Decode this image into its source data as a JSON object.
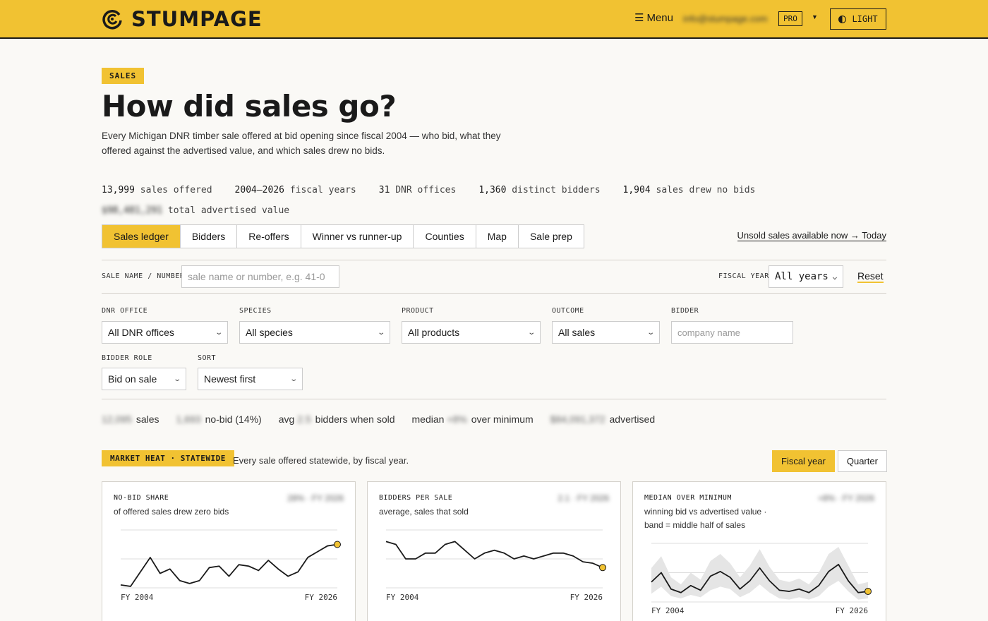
{
  "header": {
    "brand": "STUMPAGE",
    "menu_label": "Menu",
    "user_email": "info@stumpage.com",
    "plan_badge": "PRO",
    "theme_label": "LIGHT"
  },
  "hero": {
    "section_tag": "SALES",
    "title": "How did sales go?",
    "description": "Every Michigan DNR timber sale offered at bid opening since fiscal 2004 — who bid, what they offered against the advertised value, and which sales drew no bids."
  },
  "stats": [
    {
      "value": "13,999",
      "label": "sales offered"
    },
    {
      "value": "2004–2026",
      "label": "fiscal years"
    },
    {
      "value": "31",
      "label": "DNR offices"
    },
    {
      "value": "1,360",
      "label": "distinct bidders"
    },
    {
      "value": "1,904",
      "label": "sales drew no bids"
    }
  ],
  "advertised_total": {
    "value": "$98,481,291",
    "label": "total advertised value"
  },
  "tabs": [
    "Sales ledger",
    "Bidders",
    "Re-offers",
    "Winner vs runner-up",
    "Counties",
    "Map",
    "Sale prep"
  ],
  "active_tab": "Sales ledger",
  "unsold_link": "Unsold sales available now → Today",
  "filters": {
    "sale_name_label": "SALE NAME / NUMBER",
    "sale_name_placeholder": "sale name or number, e.g. 41-0",
    "fiscal_year_label": "FISCAL YEAR",
    "fiscal_year_value": "All years",
    "reset_label": "Reset",
    "dnr_office_label": "DNR OFFICE",
    "dnr_office_value": "All DNR offices",
    "species_label": "SPECIES",
    "species_value": "All species",
    "product_label": "PRODUCT",
    "product_value": "All products",
    "outcome_label": "OUTCOME",
    "outcome_value": "All sales",
    "bidder_label": "BIDDER",
    "bidder_placeholder": "company name",
    "bidder_role_label": "BIDDER ROLE",
    "bidder_role_value": "Bid on sale",
    "sort_label": "SORT",
    "sort_value": "Newest first"
  },
  "summary": {
    "sales_value": "12,095",
    "sales_label": "sales",
    "nobid_value": "1,693",
    "nobid_label": "no-bid (14%)",
    "avg_prefix": "avg",
    "avg_value": "2.5",
    "avg_label": "bidders when sold",
    "median_prefix": "median",
    "median_value": "+8%",
    "median_label": "over minimum",
    "advertised_value": "$84,091,372",
    "advertised_label": "advertised"
  },
  "market_heat": {
    "tag": "MARKET HEAT · STATEWIDE",
    "description": "Every sale offered statewide, by fiscal year.",
    "period_options": [
      "Fiscal year",
      "Quarter"
    ],
    "active_period": "Fiscal year"
  },
  "cards": [
    {
      "title": "NO-BID SHARE",
      "subtitle": "of offered sales drew zero bids",
      "value": "28% · FY 2026",
      "x_start": "FY 2004",
      "x_end": "FY 2026"
    },
    {
      "title": "BIDDERS PER SALE",
      "subtitle": "average, sales that sold",
      "value": "2.1 · FY 2026",
      "x_start": "FY 2004",
      "x_end": "FY 2026"
    },
    {
      "title": "MEDIAN OVER MINIMUM",
      "subtitle": "winning bid vs advertised value · band = middle half of sales",
      "value": "+8% · FY 2026",
      "x_start": "FY 2004",
      "x_end": "FY 2026"
    }
  ],
  "chart_data": [
    {
      "type": "line",
      "title": "NO-BID SHARE",
      "x": [
        "FY 2004",
        "FY 2005",
        "FY 2006",
        "FY 2007",
        "FY 2008",
        "FY 2009",
        "FY 2010",
        "FY 2011",
        "FY 2012",
        "FY 2013",
        "FY 2014",
        "FY 2015",
        "FY 2016",
        "FY 2017",
        "FY 2018",
        "FY 2019",
        "FY 2020",
        "FY 2021",
        "FY 2022",
        "FY 2023",
        "FY 2024",
        "FY 2025",
        "FY 2026"
      ],
      "series": [
        {
          "values": [
            0.02,
            0.01,
            0.11,
            0.21,
            0.1,
            0.13,
            0.05,
            0.03,
            0.05,
            0.14,
            0.15,
            0.08,
            0.16,
            0.15,
            0.12,
            0.19,
            0.13,
            0.08,
            0.11,
            0.21,
            0.25,
            0.29,
            0.3
          ]
        }
      ],
      "ylim": [
        0,
        0.4
      ],
      "color": "#1a1a1a",
      "highlight_color": "#f1c232"
    },
    {
      "type": "line",
      "title": "BIDDERS PER SALE",
      "x": [
        "FY 2004",
        "FY 2005",
        "FY 2006",
        "FY 2007",
        "FY 2008",
        "FY 2009",
        "FY 2010",
        "FY 2011",
        "FY 2012",
        "FY 2013",
        "FY 2014",
        "FY 2015",
        "FY 2016",
        "FY 2017",
        "FY 2018",
        "FY 2019",
        "FY 2020",
        "FY 2021",
        "FY 2022",
        "FY 2023",
        "FY 2024",
        "FY 2025",
        "FY 2026"
      ],
      "series": [
        {
          "values": [
            3.1,
            3.0,
            2.5,
            2.5,
            2.7,
            2.7,
            3.0,
            3.1,
            2.8,
            2.5,
            2.7,
            2.8,
            2.7,
            2.5,
            2.6,
            2.5,
            2.6,
            2.7,
            2.7,
            2.6,
            2.4,
            2.35,
            2.2
          ]
        }
      ],
      "ylim": [
        1.5,
        3.5
      ],
      "color": "#1a1a1a",
      "highlight_color": "#f1c232"
    },
    {
      "type": "line",
      "title": "MEDIAN OVER MINIMUM",
      "x": [
        "FY 2004",
        "FY 2005",
        "FY 2006",
        "FY 2007",
        "FY 2008",
        "FY 2009",
        "FY 2010",
        "FY 2011",
        "FY 2012",
        "FY 2013",
        "FY 2014",
        "FY 2015",
        "FY 2016",
        "FY 2017",
        "FY 2018",
        "FY 2019",
        "FY 2020",
        "FY 2021",
        "FY 2022",
        "FY 2023",
        "FY 2024",
        "FY 2025",
        "FY 2026"
      ],
      "series": [
        {
          "values": [
            12,
            20,
            6,
            3,
            9,
            5,
            17,
            21,
            16,
            6,
            13,
            24,
            13,
            5,
            4,
            6,
            3,
            9,
            21,
            27,
            13,
            3,
            4
          ]
        },
        {
          "band_low": [
            2,
            8,
            0,
            -2,
            1,
            -1,
            5,
            8,
            6,
            -1,
            3,
            10,
            3,
            -2,
            -3,
            -1,
            -3,
            0,
            8,
            13,
            4,
            -3,
            -2
          ]
        },
        {
          "band_high": [
            24,
            34,
            16,
            10,
            20,
            14,
            30,
            36,
            28,
            16,
            26,
            40,
            25,
            14,
            12,
            15,
            10,
            20,
            36,
            42,
            26,
            10,
            12
          ]
        }
      ],
      "ylim": [
        -5,
        45
      ],
      "color": "#1a1a1a",
      "band_color": "#e5e5e5",
      "highlight_color": "#f1c232"
    }
  ]
}
